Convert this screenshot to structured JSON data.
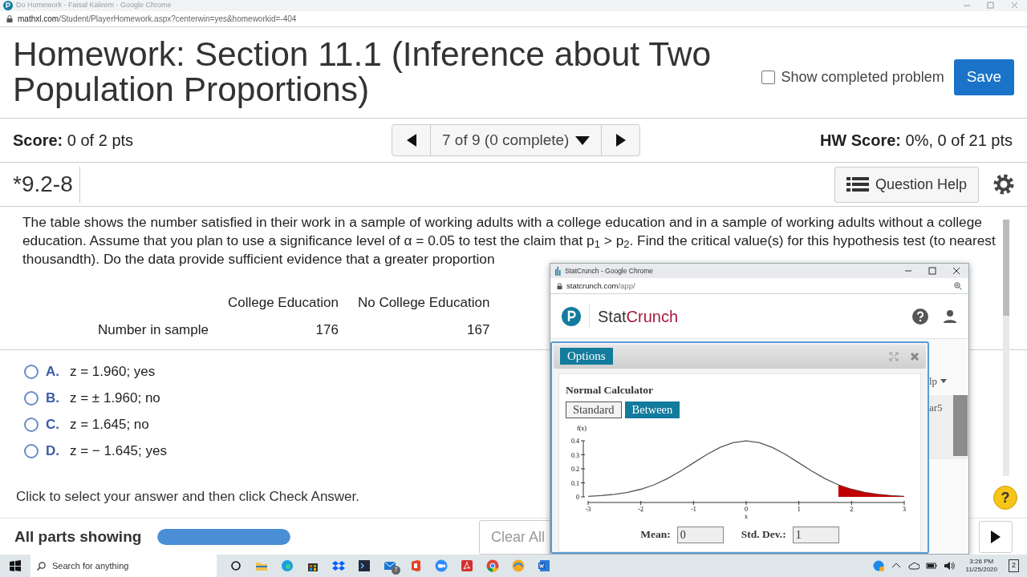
{
  "browser": {
    "title": "Do Homework - Faisal Kaleem - Google Chrome",
    "url_host": "mathxl.com",
    "url_path": "/Student/PlayerHomework.aspx?centerwin=yes&homeworkid=-404"
  },
  "header": {
    "title": "Homework: Section 11.1 (Inference about Two Population Proportions)",
    "show_completed": {
      "label": "Show completed problem",
      "checked": false
    },
    "save": "Save"
  },
  "score": {
    "label": "Score:",
    "value": "0 of 2 pts"
  },
  "navigator": {
    "position": "7 of 9 (0 complete)"
  },
  "hw_score": {
    "label": "HW Score:",
    "value": "0%, 0 of 21 pts"
  },
  "question": {
    "id": "*9.2-8",
    "help": "Question Help"
  },
  "problem": {
    "text": "The table shows the number satisfied in their work in a sample of working adults with a college education and in a sample of working adults without a college education. Assume that you plan to use a significance level of α = 0.05 to test the claim that p$_{1}$  >  p$_{2}$. Find the critical value(s) for this hypothesis test (to nearest thousandth). Do the data provide sufficient evidence that a greater proportion"
  },
  "table": {
    "columns": [
      "College Education",
      "No College Education"
    ],
    "rows": [
      {
        "label": "Number in sample",
        "values": [
          "176",
          "167"
        ]
      }
    ]
  },
  "choices": [
    {
      "letter": "A.",
      "text": "z = 1.960; yes",
      "selected": false
    },
    {
      "letter": "B.",
      "text": "z = ± 1.960; no",
      "selected": false
    },
    {
      "letter": "C.",
      "text": "z = 1.645; no",
      "selected": false
    },
    {
      "letter": "D.",
      "text": "z = − 1.645; yes",
      "selected": false
    }
  ],
  "instruction": "Click to select your answer and then click Check Answer.",
  "footer": {
    "parts_label": "All parts showing",
    "level": 1,
    "clear": "Clear All",
    "help": "?"
  },
  "statcrunch": {
    "title": "StatCrunch - Google Chrome",
    "url_host": "statcrunch.com",
    "url_path": "/app/",
    "brand": [
      "Stat",
      "Crunch"
    ],
    "menu_fragment": "lp",
    "cell_fragment": "ar5",
    "dialog": {
      "options": "Options",
      "title": "Normal Calculator",
      "modes": [
        {
          "label": "Standard",
          "selected": false
        },
        {
          "label": "Between",
          "selected": true
        }
      ],
      "chart_data": {
        "type": "line",
        "xlabel": "x",
        "ylabel": "f(x)",
        "x": [
          -3,
          -2.75,
          -2.5,
          -2.25,
          -2,
          -1.75,
          -1.5,
          -1.25,
          -1,
          -0.75,
          -0.5,
          -0.25,
          0,
          0.25,
          0.5,
          0.75,
          1,
          1.25,
          1.5,
          1.75,
          2,
          2.25,
          2.5,
          2.75,
          3
        ],
        "series": [
          {
            "type": "line",
            "color": "#555555",
            "values": [
              0.004,
              0.009,
              0.018,
              0.032,
              0.054,
              0.086,
              0.13,
              0.183,
              0.242,
              0.301,
              0.352,
              0.387,
              0.399,
              0.387,
              0.352,
              0.301,
              0.242,
              0.183,
              0.13,
              0.086,
              0.054,
              0.032,
              0.018,
              0.009,
              0.004
            ]
          },
          {
            "type": "area",
            "color": "#c00000",
            "values": [
              null,
              null,
              null,
              null,
              null,
              null,
              null,
              null,
              null,
              null,
              null,
              null,
              null,
              null,
              null,
              null,
              null,
              null,
              null,
              0.086,
              0.054,
              0.032,
              0.018,
              0.009,
              0.004
            ]
          }
        ],
        "xlim": [
          -3,
          3
        ],
        "ylim": [
          0,
          0.4
        ],
        "xticks": [
          -3,
          -2,
          -1,
          0,
          1,
          2,
          3
        ],
        "yticks": [
          0,
          0.1,
          0.2,
          0.3,
          0.4
        ]
      },
      "fields": [
        {
          "label": "Mean:",
          "value": "0"
        },
        {
          "label": "Std. Dev.:",
          "value": "1"
        }
      ]
    }
  },
  "taskbar": {
    "search_placeholder": "Search for anything",
    "mail_badge": "7",
    "time": "3:26 PM",
    "date": "11/25/2020",
    "notifications": "2"
  }
}
